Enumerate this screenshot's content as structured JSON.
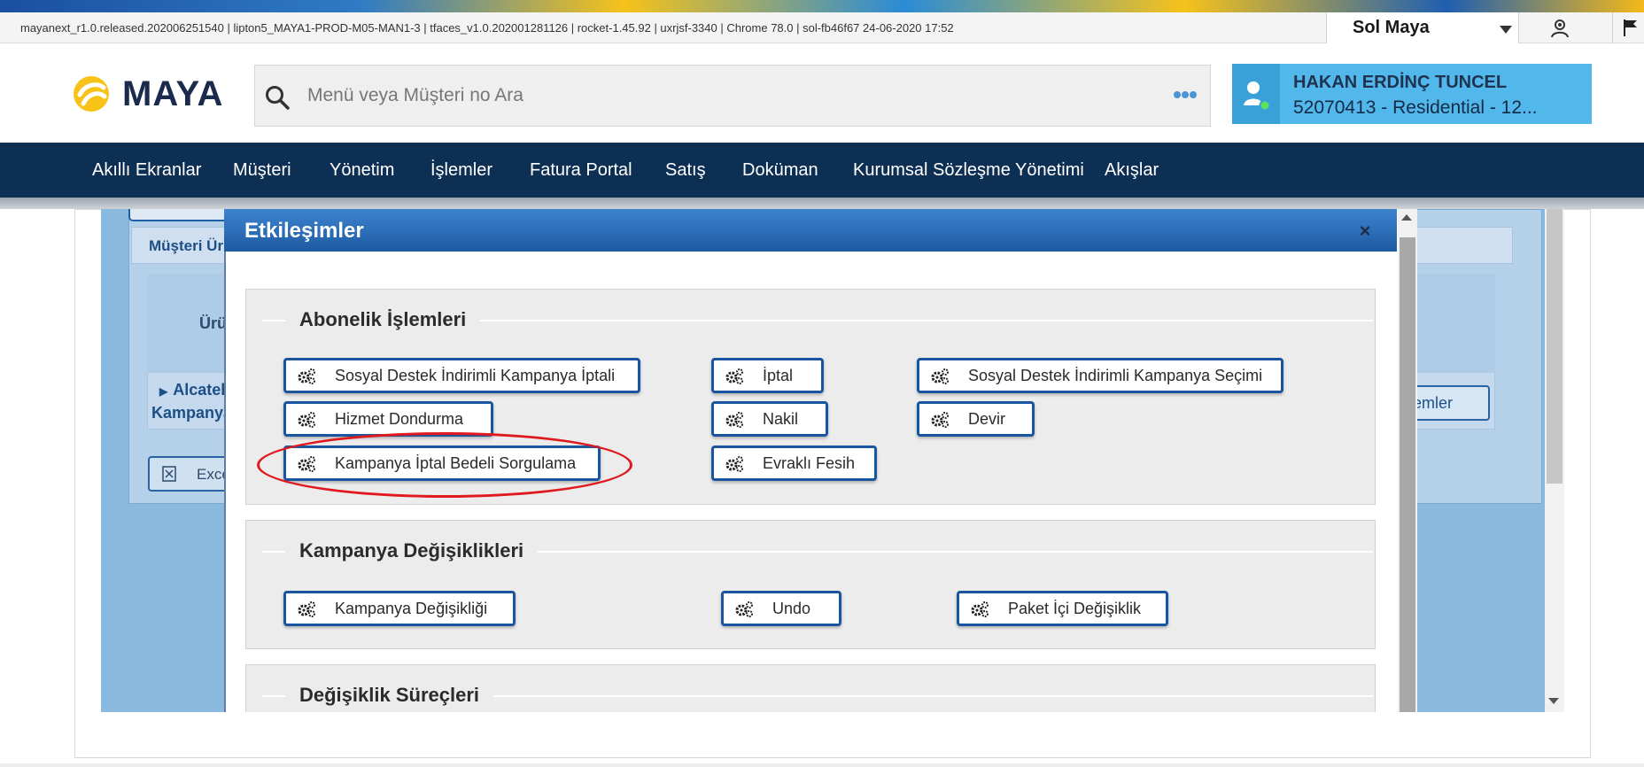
{
  "topbar": {
    "version_text": "mayanext_r1.0.released.202006251540 | lipton5_MAYA1-PROD-M05-MAN1-3 | tfaces_v1.0.202001281126 | rocket-1.45.92 | uxrjsf-3340 | Chrome 78.0 | sol-fb46f67 24-06-2020 17:52",
    "user_select_value": "Sol Maya",
    "icons": [
      "profile-icon",
      "flag-icon"
    ]
  },
  "header": {
    "logo_text": "MAYA",
    "search_placeholder": "Menü veya Müşteri no Ara",
    "customer_name": "HAKAN ERDİNÇ TUNCEL",
    "customer_sub": "52070413 - Residential - 12..."
  },
  "nav": {
    "items": [
      "Akıllı Ekranlar",
      "Müşteri",
      "Yönetim",
      "İşlemler",
      "Fatura Portal",
      "Satış",
      "Doküman",
      "Kurumsal Sözleşme Yönetimi",
      "Akışlar"
    ]
  },
  "background": {
    "musteri_label": "Müşteri Ür",
    "urun_label": "Ürü",
    "alcatel_label": "Alcatel",
    "kampanya_label": "Kampanya",
    "excel_label": "Exce",
    "emler_label": "emler"
  },
  "dialog": {
    "title": "Etkileşimler",
    "close": "×",
    "sections": [
      {
        "title": "Abonelik İşlemleri",
        "buttons": [
          "Sosyal Destek İndirimli Kampanya İptali",
          "İptal",
          "Sosyal Destek İndirimli Kampanya Seçimi",
          "Hizmet Dondurma",
          "Nakil",
          "Devir",
          "Kampanya İptal Bedeli Sorgulama",
          "Evraklı Fesih"
        ]
      },
      {
        "title": "Kampanya Değişiklikleri",
        "buttons": [
          "Kampanya Değişikliği",
          "Undo",
          "Paket İçi Değişiklik"
        ]
      },
      {
        "title": "Değişiklik Süreçleri",
        "buttons": []
      }
    ]
  },
  "annotation": {
    "color": "#e0191f",
    "highlighted_button": "Kampanya İptal Bedeli Sorgulama"
  },
  "colors": {
    "navbar": "#0e2f54",
    "dialog_header": "#1d5ba3",
    "button_border": "#1a56a0",
    "customer_card": "#52b7ea"
  }
}
